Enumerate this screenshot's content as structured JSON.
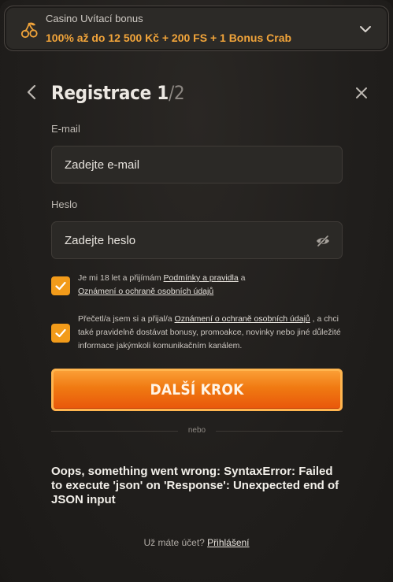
{
  "bonus": {
    "title": "Casino Uvítací bonus",
    "text": "100% až do 12 500 Kč + 200 FS + 1 Bonus Crab",
    "icon": "cherry-icon",
    "accent": "#f1a43a"
  },
  "header": {
    "title": "Registrace",
    "step": "1",
    "separator": "/",
    "total": "2"
  },
  "form": {
    "email_label": "E-mail",
    "email_placeholder": "Zadejte e-mail",
    "password_label": "Heslo",
    "password_placeholder": "Zadejte heslo"
  },
  "consents": {
    "c1_pre": "Je mi 18 let a přijímám ",
    "c1_link1": "Podmínky a pravidla",
    "c1_mid": " a ",
    "c1_link2": "Oznámení o ochraně osobních údajů",
    "c2_pre": "Přečetl/a jsem si a přijal/a ",
    "c2_link": "Oznámení o ochraně osobních údajů",
    "c2_post": " , a chci také pravidelně dostávat bonusy, promoakce, novinky nebo jiné důležité informace jakýmkoli komunikačním kanálem.",
    "checked_color": "#f29b1a"
  },
  "cta": {
    "label": "DALŠÍ KROK"
  },
  "divider_text": "nebo",
  "error": "Oops, something went wrong: SyntaxError: Failed to execute 'json' on 'Response': Unexpected end of JSON input",
  "footer": {
    "text": "Už máte účet? ",
    "link": "Přihlášení"
  }
}
